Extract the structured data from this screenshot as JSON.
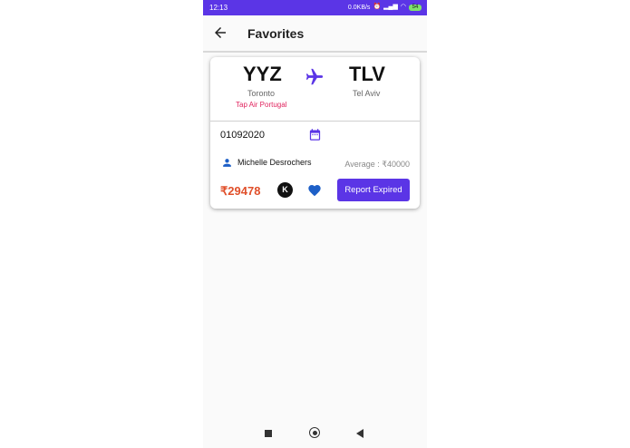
{
  "colors": {
    "accent": "#5b35e6",
    "price": "#e0502b",
    "airline": "#e0245e",
    "heart": "#1d5fc7"
  },
  "statusbar": {
    "time": "12:13",
    "network": "0.0KB/s",
    "battery": "54"
  },
  "appbar": {
    "title": "Favorites",
    "back_icon": "arrow-left-icon"
  },
  "flight": {
    "from_code": "YYZ",
    "from_city": "Toronto",
    "to_code": "TLV",
    "to_city": "Tel Aviv",
    "airline": "Tap Air Portugal",
    "date": "01092020",
    "traveler": "Michelle Desrochers",
    "average": "Average : ₹40000",
    "price": "₹29478",
    "kayak_label": "K",
    "report_button": "Report Expired"
  }
}
